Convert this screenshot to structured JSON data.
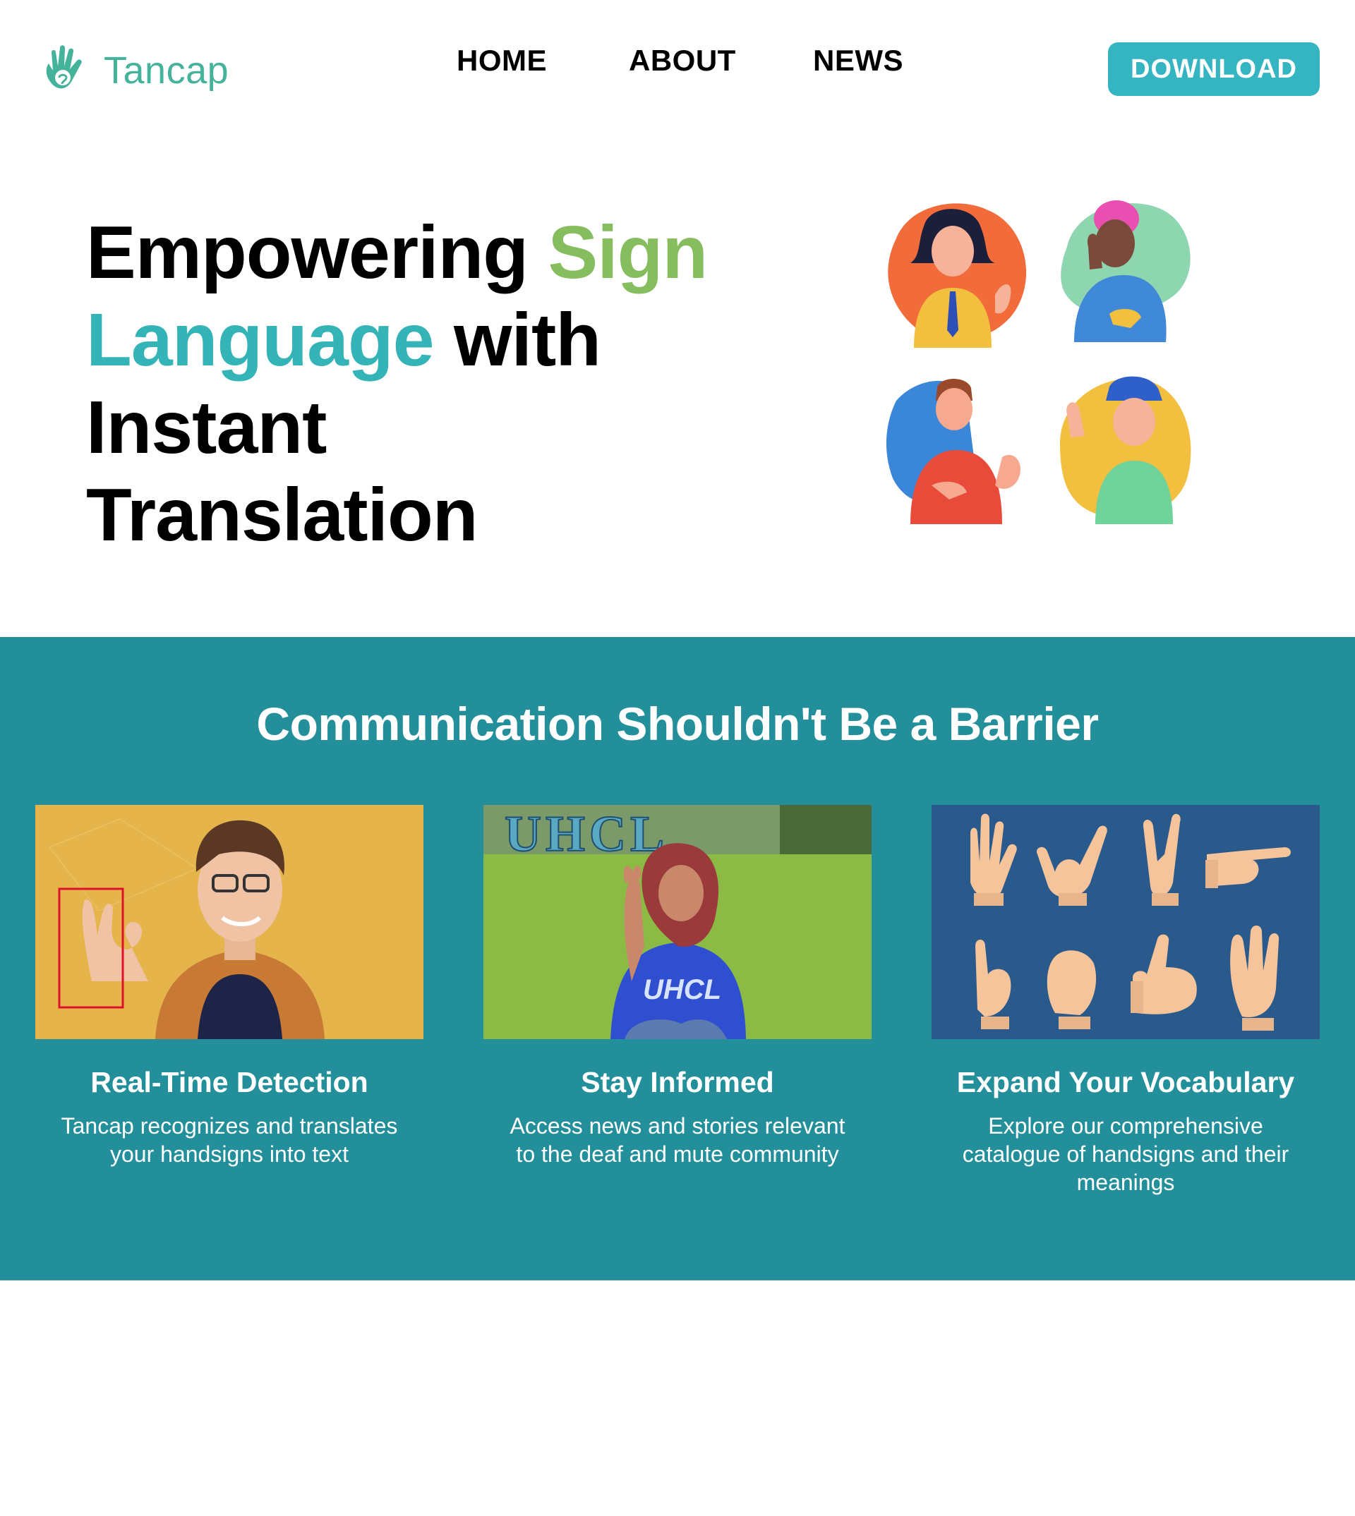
{
  "brand": {
    "name": "Tancap",
    "color": "#45b39b"
  },
  "nav": {
    "items": [
      {
        "label": "HOME"
      },
      {
        "label": "ABOUT"
      },
      {
        "label": "NEWS"
      }
    ],
    "download_label": "DOWNLOAD",
    "download_color": "#35b4c2"
  },
  "hero": {
    "title_part1": "Empowering ",
    "title_sign": "Sign",
    "title_language": "Language",
    "title_part2": " with",
    "title_part3": "Instant Translation",
    "accent_green": "#86bd5e",
    "accent_teal": "#35b4b8",
    "illustration_icons": [
      "signing-woman-icon",
      "signing-man-pink-hair-icon",
      "signing-man-red-shirt-icon",
      "signing-woman-cap-icon"
    ]
  },
  "features": {
    "background": "#238f9b",
    "title": "Communication Shouldn't Be a Barrier",
    "cards": [
      {
        "title": "Real-Time Detection",
        "text": "Tancap recognizes and translates your handsigns into text",
        "image": "man-ok-sign-photo"
      },
      {
        "title": "Stay Informed",
        "text": "Access news and stories relevant to the deaf and mute community",
        "image": "student-uhcl-photo",
        "image_sign_text": "UHCL",
        "shirt_text": "UHCL"
      },
      {
        "title": "Expand Your Vocabulary",
        "text": "Explore our comprehensive catalogue of handsigns and their meanings",
        "image": "hand-signs-grid"
      }
    ]
  }
}
